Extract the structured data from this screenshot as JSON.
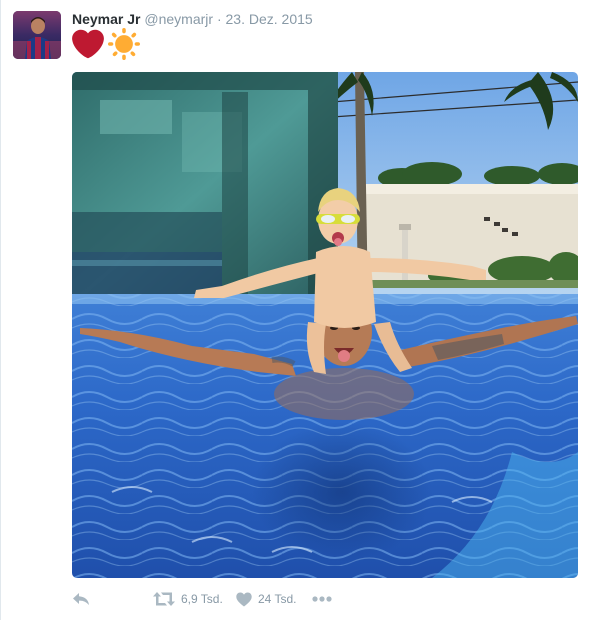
{
  "tweet": {
    "author": {
      "fullname": "Neymar Jr",
      "username": "@neymarjr"
    },
    "separator": "·",
    "date": "23. Dez. 2015",
    "content_emojis": [
      "heart-emoji",
      "sun-emoji"
    ],
    "media": {
      "type": "photo"
    },
    "actions": {
      "reply": {
        "icon": "reply-icon"
      },
      "retweet": {
        "icon": "retweet-icon",
        "count": "6,9 Tsd."
      },
      "like": {
        "icon": "heart-icon",
        "count": "24 Tsd."
      },
      "more": {
        "icon": "more-icon"
      }
    }
  },
  "colors": {
    "name": "#292f33",
    "meta": "#8899a6",
    "action_icon": "#aab8c2",
    "emoji_heart": "#be1931",
    "emoji_sun": "#ffac33"
  }
}
